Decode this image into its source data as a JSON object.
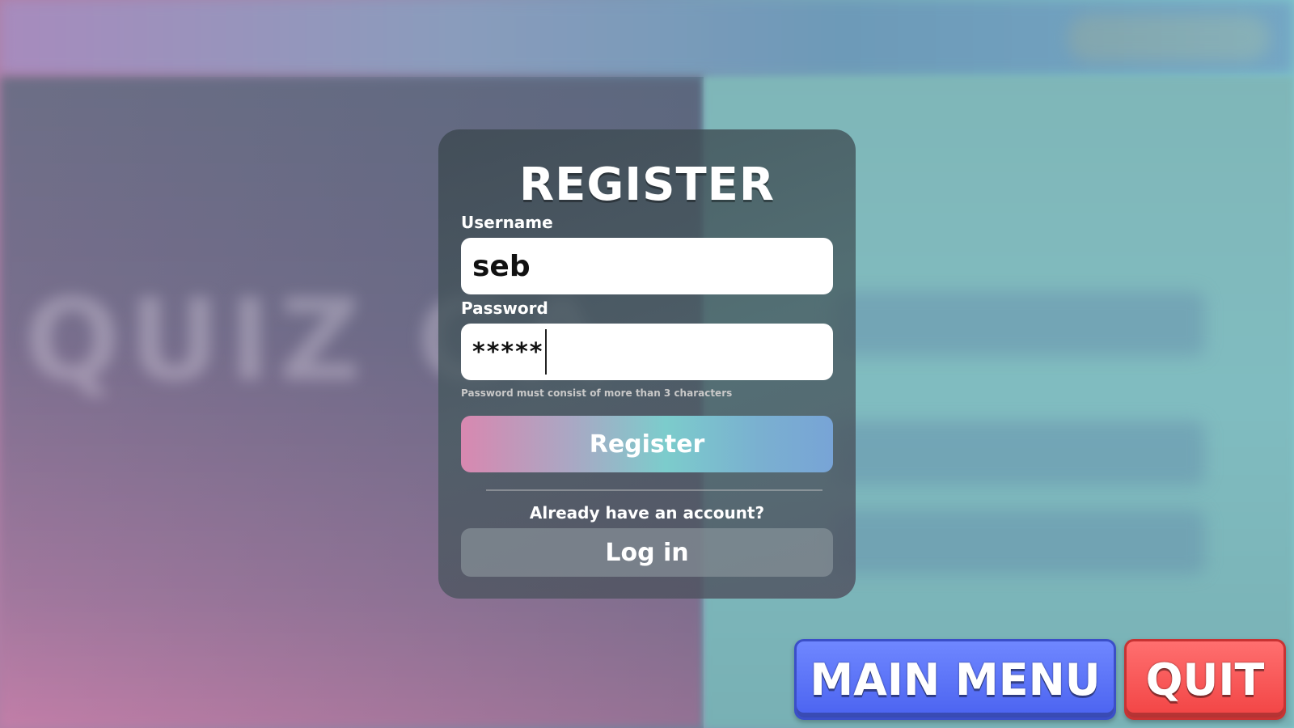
{
  "background": {
    "blurred_title": "QUIZ GA"
  },
  "register_modal": {
    "title": "REGISTER",
    "username_label": "Username",
    "username_value": "seb",
    "password_label": "Password",
    "password_value_masked": "*****",
    "password_hint": "Password must consist of more than 3 characters",
    "register_button_label": "Register",
    "already_account_text": "Already have an account?",
    "login_button_label": "Log in"
  },
  "bottom_bar": {
    "main_menu_label": "MAIN MENU",
    "quit_label": "QUIT"
  },
  "colors": {
    "main_menu_blue": "#4b63f0",
    "quit_red": "#f24444",
    "register_gradient_start": "#d888b0",
    "register_gradient_end": "#78a4d6"
  }
}
